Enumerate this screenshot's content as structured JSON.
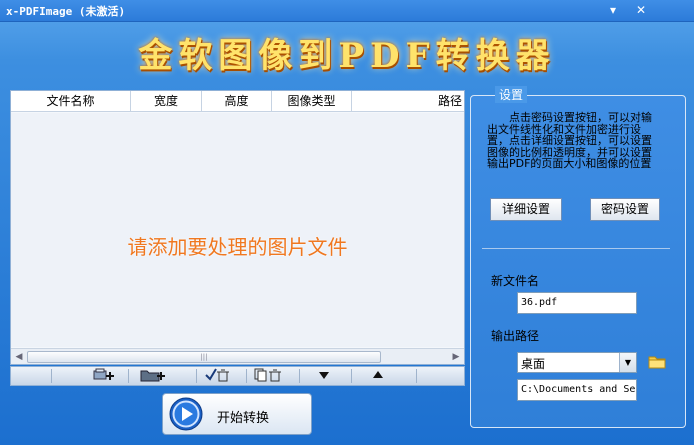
{
  "window": {
    "title": "x-PDFImage (未激活)",
    "minimize_glyph": "▾",
    "close_glyph": "✕"
  },
  "banner": {
    "title": "金软图像到PDF转换器"
  },
  "file_table": {
    "columns": [
      "文件名称",
      "宽度",
      "高度",
      "图像类型",
      "路径"
    ],
    "empty_hint": "请添加要处理的图片文件",
    "rows": []
  },
  "toolbar": {
    "icons": [
      "add-file-icon",
      "add-folder-icon",
      "delete-checked-icon",
      "delete-all-icon",
      "move-down-icon",
      "move-up-icon"
    ]
  },
  "start_button": {
    "label": "开始转换"
  },
  "settings": {
    "title": "设置",
    "description": "点击密码设置按钮，可以对输出文件线性化和文件加密进行设置，点击详细设置按钮，可以设置图像的比例和透明度，并可以设置输出PDF的页面大小和图像的位置",
    "detail_button": "详细设置",
    "password_button": "密码设置",
    "new_filename_label": "新文件名",
    "new_filename_value": "36.pdf",
    "output_path_label": "输出路径",
    "output_path_option": "桌面",
    "output_path_value": "C:\\Documents and Se"
  }
}
